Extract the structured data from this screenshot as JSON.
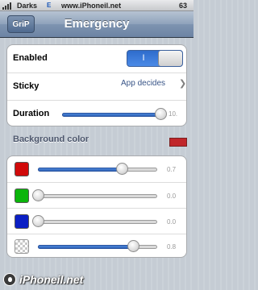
{
  "status_bar": {
    "carrier": "Darks",
    "network": "E",
    "url": "www.iPhoneil.net",
    "battery_text": "63"
  },
  "nav": {
    "back_label": "GriP",
    "title": "Emergency"
  },
  "settings": {
    "enabled": {
      "label": "Enabled",
      "on_label": "I",
      "state": true
    },
    "sticky": {
      "label": "Sticky",
      "value": "App decides"
    },
    "duration": {
      "label": "Duration",
      "value": 1.0,
      "value_text": "10."
    }
  },
  "background_color": {
    "header": "Background color",
    "preview_color": "#c0262a",
    "channels": [
      {
        "name": "red",
        "swatch_color": "#d10a0a",
        "value": 0.7,
        "value_text": "0.7"
      },
      {
        "name": "green",
        "swatch_color": "#0ab50a",
        "value": 0.0,
        "value_text": "0.0"
      },
      {
        "name": "blue",
        "swatch_color": "#0b1fc4",
        "value": 0.0,
        "value_text": "0.0"
      },
      {
        "name": "alpha",
        "swatch_color": "checkerboard",
        "value": 0.8,
        "value_text": "0.8"
      }
    ]
  },
  "watermark": {
    "text": "iPhoneil.net"
  }
}
